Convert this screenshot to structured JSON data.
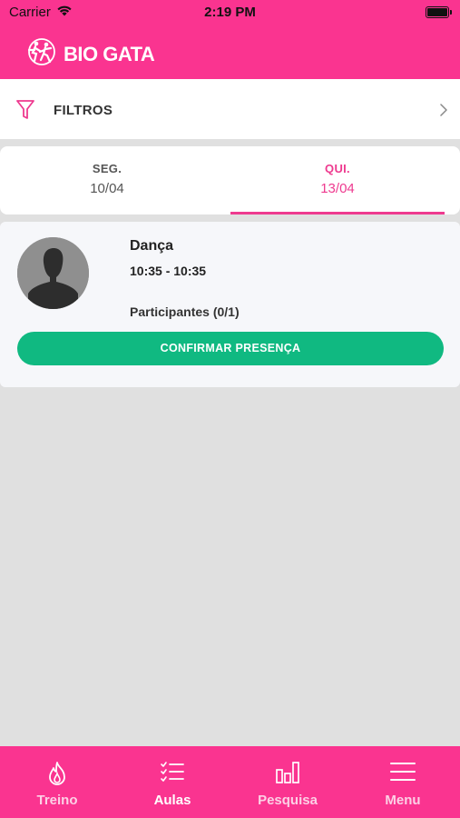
{
  "status_bar": {
    "carrier": "Carrier",
    "time": "2:19 PM"
  },
  "app": {
    "logo_text": "BIO GATA",
    "brand_color": "#fa3490",
    "accent_color": "#ee3a8f",
    "confirm_color": "#10b981"
  },
  "filter": {
    "label": "FILTROS",
    "icon": "filter-icon"
  },
  "tabs": [
    {
      "day": "SEG.",
      "date": "10/04",
      "active": false
    },
    {
      "day": "QUI.",
      "date": "13/04",
      "active": true
    }
  ],
  "class_card": {
    "name": "Dança",
    "time": "10:35 - 10:35",
    "participants": "Participantes (0/1)",
    "confirm_label": "CONFIRMAR PRESENÇA"
  },
  "bottom_nav": [
    {
      "label": "Treino",
      "icon": "flame-icon",
      "active": false
    },
    {
      "label": "Aulas",
      "icon": "checklist-icon",
      "active": true
    },
    {
      "label": "Pesquisa",
      "icon": "bar-chart-icon",
      "active": false
    },
    {
      "label": "Menu",
      "icon": "menu-icon",
      "active": false
    }
  ]
}
